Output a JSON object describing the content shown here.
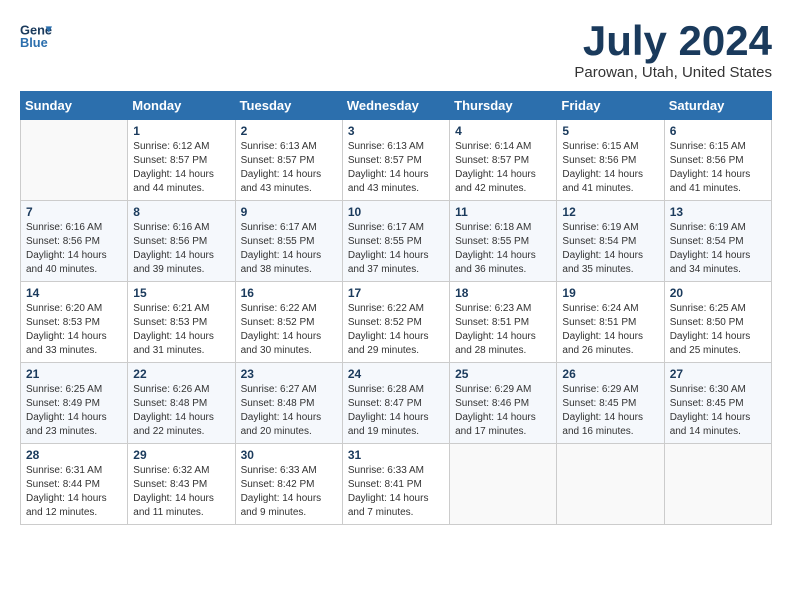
{
  "logo": {
    "line1": "General",
    "line2": "Blue"
  },
  "title": "July 2024",
  "location": "Parowan, Utah, United States",
  "days_of_week": [
    "Sunday",
    "Monday",
    "Tuesday",
    "Wednesday",
    "Thursday",
    "Friday",
    "Saturday"
  ],
  "weeks": [
    [
      {
        "day": "",
        "sunrise": "",
        "sunset": "",
        "daylight": ""
      },
      {
        "day": "1",
        "sunrise": "Sunrise: 6:12 AM",
        "sunset": "Sunset: 8:57 PM",
        "daylight": "Daylight: 14 hours and 44 minutes."
      },
      {
        "day": "2",
        "sunrise": "Sunrise: 6:13 AM",
        "sunset": "Sunset: 8:57 PM",
        "daylight": "Daylight: 14 hours and 43 minutes."
      },
      {
        "day": "3",
        "sunrise": "Sunrise: 6:13 AM",
        "sunset": "Sunset: 8:57 PM",
        "daylight": "Daylight: 14 hours and 43 minutes."
      },
      {
        "day": "4",
        "sunrise": "Sunrise: 6:14 AM",
        "sunset": "Sunset: 8:57 PM",
        "daylight": "Daylight: 14 hours and 42 minutes."
      },
      {
        "day": "5",
        "sunrise": "Sunrise: 6:15 AM",
        "sunset": "Sunset: 8:56 PM",
        "daylight": "Daylight: 14 hours and 41 minutes."
      },
      {
        "day": "6",
        "sunrise": "Sunrise: 6:15 AM",
        "sunset": "Sunset: 8:56 PM",
        "daylight": "Daylight: 14 hours and 41 minutes."
      }
    ],
    [
      {
        "day": "7",
        "sunrise": "Sunrise: 6:16 AM",
        "sunset": "Sunset: 8:56 PM",
        "daylight": "Daylight: 14 hours and 40 minutes."
      },
      {
        "day": "8",
        "sunrise": "Sunrise: 6:16 AM",
        "sunset": "Sunset: 8:56 PM",
        "daylight": "Daylight: 14 hours and 39 minutes."
      },
      {
        "day": "9",
        "sunrise": "Sunrise: 6:17 AM",
        "sunset": "Sunset: 8:55 PM",
        "daylight": "Daylight: 14 hours and 38 minutes."
      },
      {
        "day": "10",
        "sunrise": "Sunrise: 6:17 AM",
        "sunset": "Sunset: 8:55 PM",
        "daylight": "Daylight: 14 hours and 37 minutes."
      },
      {
        "day": "11",
        "sunrise": "Sunrise: 6:18 AM",
        "sunset": "Sunset: 8:55 PM",
        "daylight": "Daylight: 14 hours and 36 minutes."
      },
      {
        "day": "12",
        "sunrise": "Sunrise: 6:19 AM",
        "sunset": "Sunset: 8:54 PM",
        "daylight": "Daylight: 14 hours and 35 minutes."
      },
      {
        "day": "13",
        "sunrise": "Sunrise: 6:19 AM",
        "sunset": "Sunset: 8:54 PM",
        "daylight": "Daylight: 14 hours and 34 minutes."
      }
    ],
    [
      {
        "day": "14",
        "sunrise": "Sunrise: 6:20 AM",
        "sunset": "Sunset: 8:53 PM",
        "daylight": "Daylight: 14 hours and 33 minutes."
      },
      {
        "day": "15",
        "sunrise": "Sunrise: 6:21 AM",
        "sunset": "Sunset: 8:53 PM",
        "daylight": "Daylight: 14 hours and 31 minutes."
      },
      {
        "day": "16",
        "sunrise": "Sunrise: 6:22 AM",
        "sunset": "Sunset: 8:52 PM",
        "daylight": "Daylight: 14 hours and 30 minutes."
      },
      {
        "day": "17",
        "sunrise": "Sunrise: 6:22 AM",
        "sunset": "Sunset: 8:52 PM",
        "daylight": "Daylight: 14 hours and 29 minutes."
      },
      {
        "day": "18",
        "sunrise": "Sunrise: 6:23 AM",
        "sunset": "Sunset: 8:51 PM",
        "daylight": "Daylight: 14 hours and 28 minutes."
      },
      {
        "day": "19",
        "sunrise": "Sunrise: 6:24 AM",
        "sunset": "Sunset: 8:51 PM",
        "daylight": "Daylight: 14 hours and 26 minutes."
      },
      {
        "day": "20",
        "sunrise": "Sunrise: 6:25 AM",
        "sunset": "Sunset: 8:50 PM",
        "daylight": "Daylight: 14 hours and 25 minutes."
      }
    ],
    [
      {
        "day": "21",
        "sunrise": "Sunrise: 6:25 AM",
        "sunset": "Sunset: 8:49 PM",
        "daylight": "Daylight: 14 hours and 23 minutes."
      },
      {
        "day": "22",
        "sunrise": "Sunrise: 6:26 AM",
        "sunset": "Sunset: 8:48 PM",
        "daylight": "Daylight: 14 hours and 22 minutes."
      },
      {
        "day": "23",
        "sunrise": "Sunrise: 6:27 AM",
        "sunset": "Sunset: 8:48 PM",
        "daylight": "Daylight: 14 hours and 20 minutes."
      },
      {
        "day": "24",
        "sunrise": "Sunrise: 6:28 AM",
        "sunset": "Sunset: 8:47 PM",
        "daylight": "Daylight: 14 hours and 19 minutes."
      },
      {
        "day": "25",
        "sunrise": "Sunrise: 6:29 AM",
        "sunset": "Sunset: 8:46 PM",
        "daylight": "Daylight: 14 hours and 17 minutes."
      },
      {
        "day": "26",
        "sunrise": "Sunrise: 6:29 AM",
        "sunset": "Sunset: 8:45 PM",
        "daylight": "Daylight: 14 hours and 16 minutes."
      },
      {
        "day": "27",
        "sunrise": "Sunrise: 6:30 AM",
        "sunset": "Sunset: 8:45 PM",
        "daylight": "Daylight: 14 hours and 14 minutes."
      }
    ],
    [
      {
        "day": "28",
        "sunrise": "Sunrise: 6:31 AM",
        "sunset": "Sunset: 8:44 PM",
        "daylight": "Daylight: 14 hours and 12 minutes."
      },
      {
        "day": "29",
        "sunrise": "Sunrise: 6:32 AM",
        "sunset": "Sunset: 8:43 PM",
        "daylight": "Daylight: 14 hours and 11 minutes."
      },
      {
        "day": "30",
        "sunrise": "Sunrise: 6:33 AM",
        "sunset": "Sunset: 8:42 PM",
        "daylight": "Daylight: 14 hours and 9 minutes."
      },
      {
        "day": "31",
        "sunrise": "Sunrise: 6:33 AM",
        "sunset": "Sunset: 8:41 PM",
        "daylight": "Daylight: 14 hours and 7 minutes."
      },
      {
        "day": "",
        "sunrise": "",
        "sunset": "",
        "daylight": ""
      },
      {
        "day": "",
        "sunrise": "",
        "sunset": "",
        "daylight": ""
      },
      {
        "day": "",
        "sunrise": "",
        "sunset": "",
        "daylight": ""
      }
    ]
  ]
}
